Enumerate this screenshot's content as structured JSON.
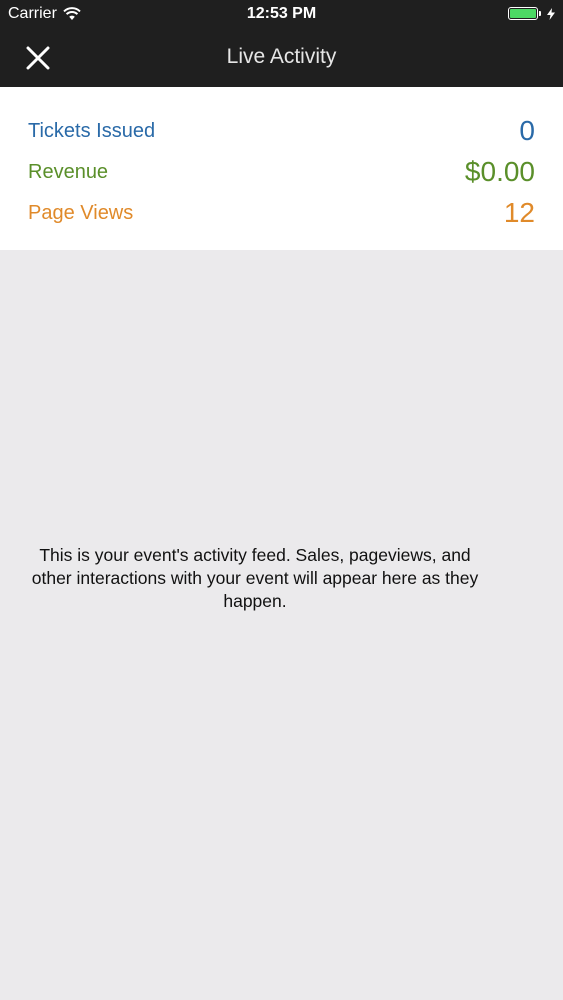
{
  "status_bar": {
    "carrier": "Carrier",
    "time": "12:53 PM",
    "battery_level": 1.0,
    "battery_color": "#4cd964",
    "icons": [
      "wifi-icon",
      "battery-icon",
      "charging-bolt-icon"
    ]
  },
  "nav": {
    "title": "Live Activity",
    "close_icon": "close-icon"
  },
  "stats": [
    {
      "label": "Tickets Issued",
      "value": "0",
      "color": "#2a6aa8"
    },
    {
      "label": "Revenue",
      "value": "$0.00",
      "color": "#5a8f2a"
    },
    {
      "label": "Page Views",
      "value": "12",
      "color": "#e08a2a"
    }
  ],
  "feed": {
    "empty_message": "This is your event's activity feed. Sales, pageviews, and other interactions with your event will appear here as they happen."
  },
  "colors": {
    "header_bg": "#1f1f1f",
    "feed_bg": "#ebeaec",
    "tickets": "#2a6aa8",
    "revenue": "#5a8f2a",
    "page_views": "#e08a2a"
  }
}
